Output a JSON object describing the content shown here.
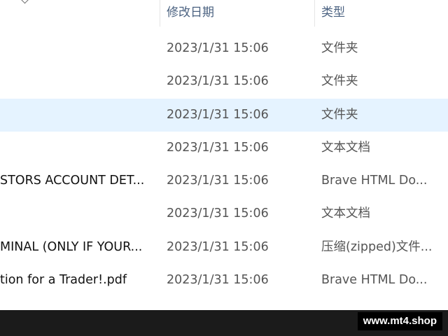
{
  "columns": {
    "date_header": "修改日期",
    "type_header": "类型"
  },
  "rows": [
    {
      "name": "",
      "date": "2023/1/31 15:06",
      "type": "文件夹",
      "selected": false
    },
    {
      "name": "",
      "date": "2023/1/31 15:06",
      "type": "文件夹",
      "selected": false
    },
    {
      "name": "",
      "date": "2023/1/31 15:06",
      "type": "文件夹",
      "selected": true
    },
    {
      "name": "",
      "date": "2023/1/31 15:06",
      "type": "文本文档",
      "selected": false
    },
    {
      "name": "STORS ACCOUNT DET...",
      "date": "2023/1/31 15:06",
      "type": "Brave HTML Do...",
      "selected": false
    },
    {
      "name": "",
      "date": "2023/1/31 15:06",
      "type": "文本文档",
      "selected": false
    },
    {
      "name": "MINAL (ONLY IF YOUR...",
      "date": "2023/1/31 15:06",
      "type": "压缩(zipped)文件...",
      "selected": false
    },
    {
      "name": "tion for a Trader!.pdf",
      "date": "2023/1/31 15:06",
      "type": "Brave HTML Do...",
      "selected": false
    }
  ],
  "watermark": "www.mt4.shop",
  "colors": {
    "selected_row": "#e5f3ff",
    "header_text": "#4b6281",
    "bottom_bar": "#1b1b1b"
  }
}
